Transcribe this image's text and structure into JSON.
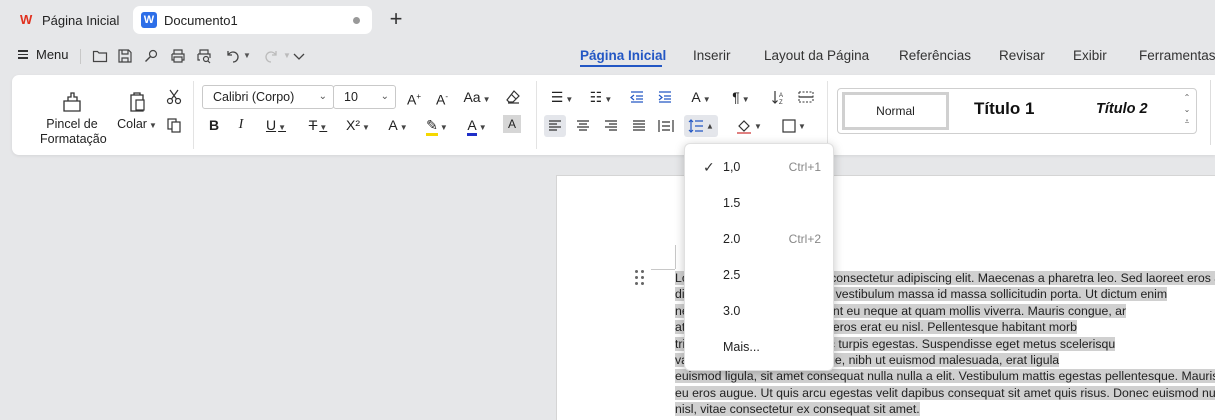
{
  "tabs": {
    "home_label": "Página Inicial",
    "doc_label": "Documento1",
    "new_tab": "+"
  },
  "menu": {
    "menu_label": "Menu",
    "ribbon_tabs": [
      "Página Inicial",
      "Inserir",
      "Layout da Página",
      "Referências",
      "Revisar",
      "Exibir",
      "Ferramentas"
    ],
    "active_tab": "Página Inicial"
  },
  "ribbon": {
    "format_painter_line1": "Pincel de",
    "format_painter_line2": "Formatação",
    "paste_label": "Colar",
    "font_name": "Calibri (Corpo)",
    "font_size": "10"
  },
  "styles": {
    "normal": "Normal",
    "title1": "Título 1",
    "title2": "Título 2"
  },
  "line_spacing_menu": {
    "items": [
      {
        "label": "1,0",
        "shortcut": "Ctrl+1",
        "checked": true
      },
      {
        "label": "1.5",
        "shortcut": "",
        "checked": false
      },
      {
        "label": "2.0",
        "shortcut": "Ctrl+2",
        "checked": false
      },
      {
        "label": "2.5",
        "shortcut": "",
        "checked": false
      },
      {
        "label": "3.0",
        "shortcut": "",
        "checked": false
      },
      {
        "label": "Mais...",
        "shortcut": "",
        "checked": false
      }
    ]
  },
  "document": {
    "lines": [
      "Lorem ipsum dolor sit amet, consectetur adipiscing elit. Maecenas a pharetra leo. Sed laoreet eros a",
      "dictum congue. Suspendisse vestibulum massa id massa sollicitudin porta. Ut dictum enim",
      "nec tortor facilisis eu. Praesent eu neque at quam mollis viverra. Mauris congue, ar",
      "at semper lorem, sed finibus eros erat eu nisl. Pellentesque habitant morb",
      "tristique malesuada fames ac turpis egestas. Suspendisse eget metus scelerisqu",
      "vallis justo. Maecenas tristique, nibh ut euismod malesuada, erat ligula",
      "euismod ligula, sit amet consequat nulla nulla a elit. Vestibulum mattis egestas pellentesque. Mauris",
      "eu eros augue. Ut quis arcu egestas velit dapibus consequat sit amet quis risus. Donec euismod nunc",
      "nisl, vitae consectetur ex consequat sit amet."
    ]
  },
  "colors": {
    "accent": "#2357c4",
    "highlight_yellow": "#f5d800",
    "font_color_blue": "#1f2fc8",
    "selection": "#d0d0d0"
  }
}
